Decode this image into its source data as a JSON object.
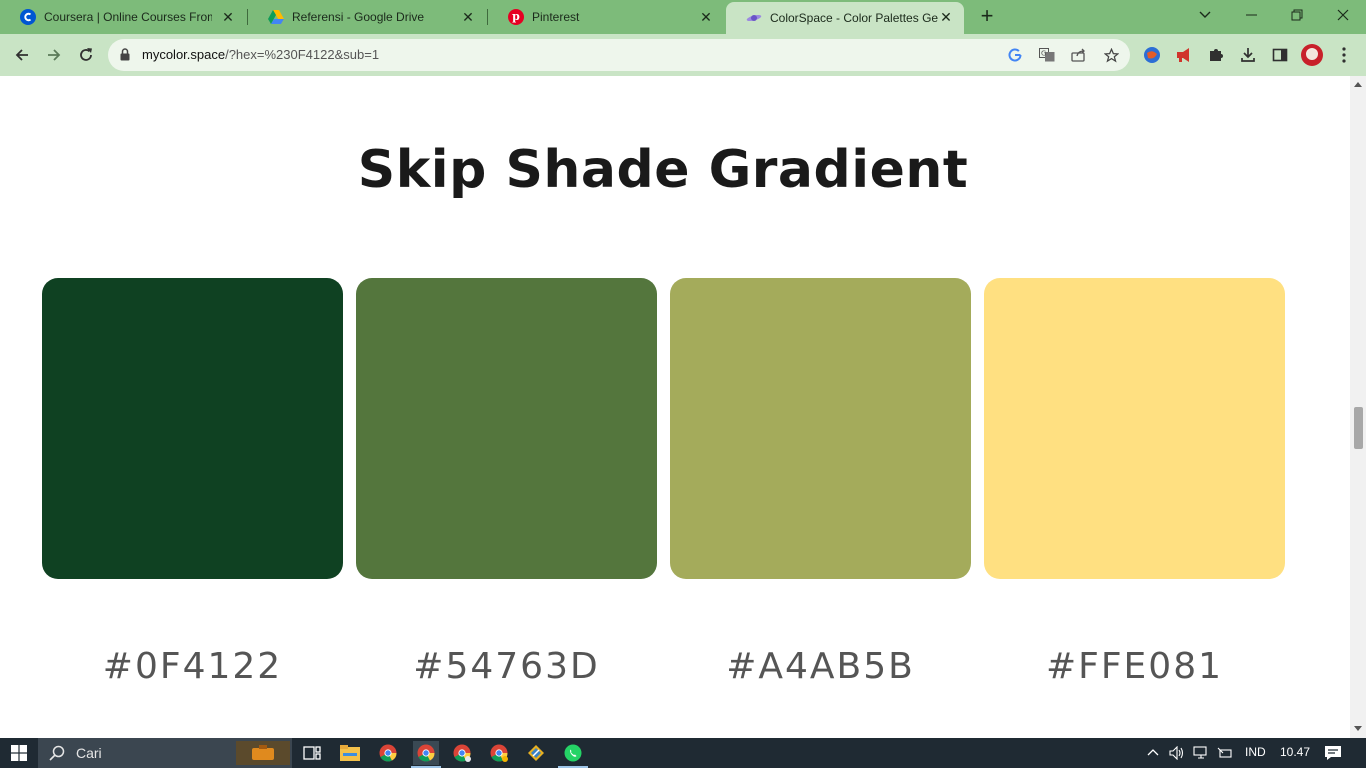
{
  "browser": {
    "tabs": [
      {
        "title": "Coursera | Online Courses From",
        "icon": "coursera-icon",
        "active": false
      },
      {
        "title": "Referensi - Google Drive",
        "icon": "google-drive-icon",
        "active": false
      },
      {
        "title": "Pinterest",
        "icon": "pinterest-icon",
        "active": false
      },
      {
        "title": "ColorSpace - Color Palettes Gen",
        "icon": "colorspace-icon",
        "active": true
      }
    ],
    "url_host": "mycolor.space",
    "url_path": "/?hex=%230F4122&sub=1"
  },
  "page": {
    "title": "Skip Shade Gradient",
    "swatches": [
      {
        "hex": "#0F4122",
        "color": "#0F4122"
      },
      {
        "hex": "#54763D",
        "color": "#54763D"
      },
      {
        "hex": "#A4AB5B",
        "color": "#A4AB5B"
      },
      {
        "hex": "#FFE081",
        "color": "#FFE081"
      }
    ]
  },
  "taskbar": {
    "search_placeholder": "Cari",
    "language": "IND",
    "time": "10.47"
  },
  "colors": {
    "tab_strip": "#7dbb7a",
    "toolbar": "#c9e4c5",
    "taskbar": "#1f2a33"
  }
}
